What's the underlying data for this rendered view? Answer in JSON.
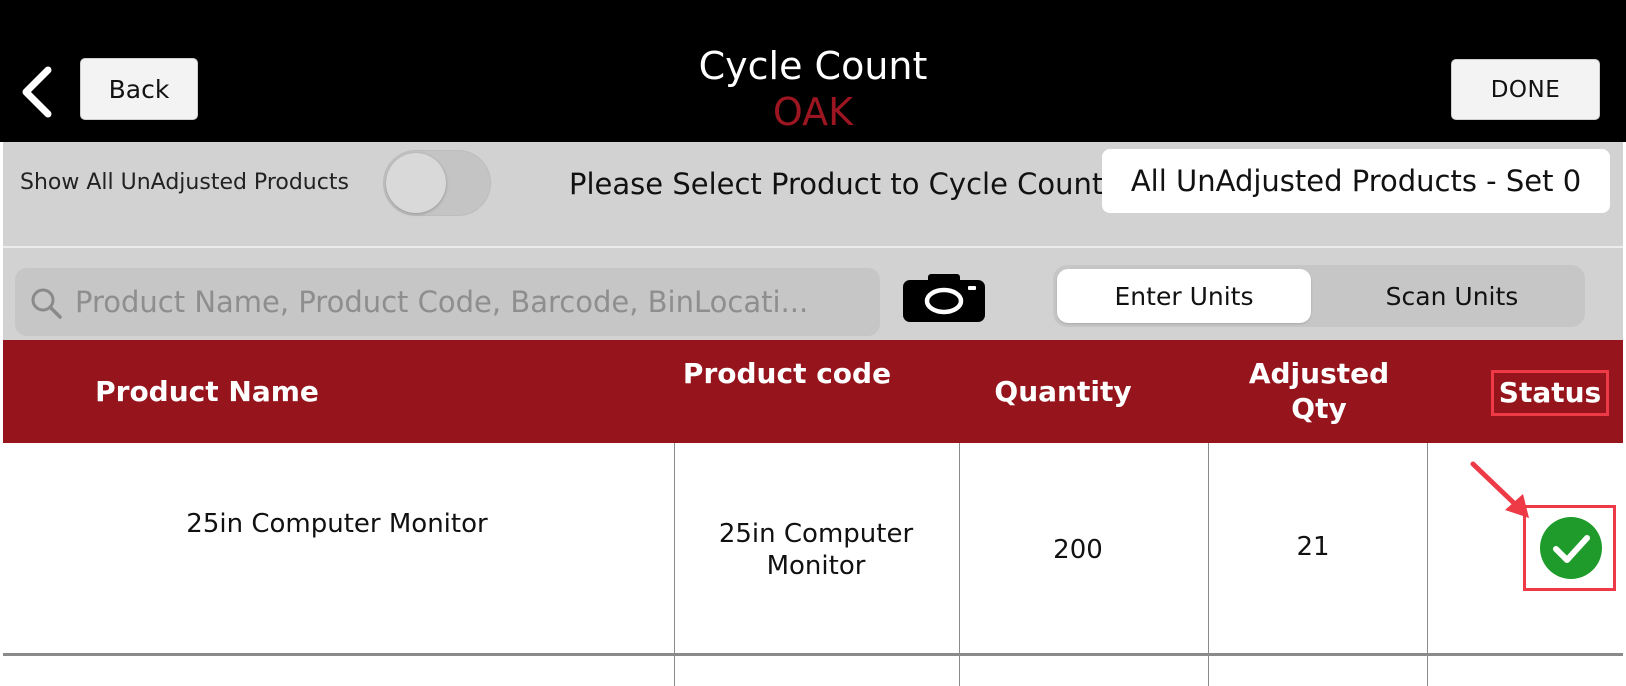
{
  "nav": {
    "title": "Cycle Count",
    "subtitle": "OAK",
    "back_label": "Back",
    "done_label": "DONE"
  },
  "filter": {
    "toggle_label": "Show All UnAdjusted Products",
    "toggle_on": false,
    "prompt": "Please Select Product to Cycle Count",
    "selected_set": "All UnAdjusted Products - Set 0"
  },
  "search": {
    "placeholder": "Product Name, Product Code, Barcode, BinLocati..."
  },
  "mode": {
    "options": [
      "Enter Units",
      "Scan Units"
    ],
    "selected": "Enter Units"
  },
  "table": {
    "headers": {
      "name": "Product Name",
      "code": "Product code",
      "quantity": "Quantity",
      "adjusted": "Adjusted Qty",
      "status": "Status"
    },
    "rows": [
      {
        "name": "25in Computer Monitor",
        "code": "25in Computer Monitor",
        "quantity": "200",
        "adjusted": "21",
        "status": "complete"
      }
    ]
  },
  "colors": {
    "header_red": "#96141c",
    "subtitle_red": "#9c1621",
    "annotation_red": "#ee3a46",
    "status_green": "#1e9b2a"
  }
}
